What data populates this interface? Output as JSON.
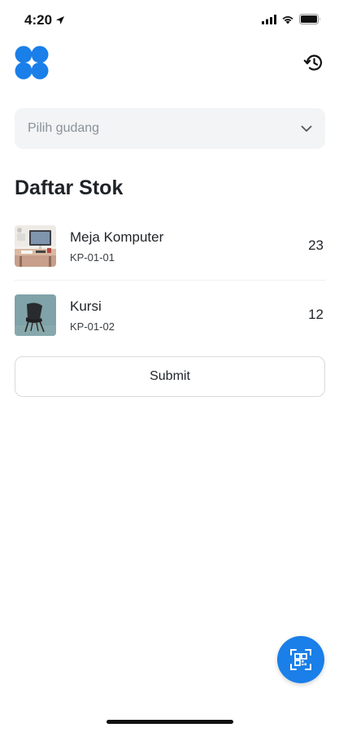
{
  "status_bar": {
    "time": "4:20"
  },
  "header": {
    "logo_icon": "app-logo-icon",
    "history_icon": "history-icon"
  },
  "warehouse_select": {
    "placeholder": "Pilih gudang",
    "icon": "chevron-down-icon"
  },
  "stock_section": {
    "title": "Daftar Stok",
    "items": [
      {
        "name": "Meja Komputer",
        "code": "KP-01-01",
        "qty": "23"
      },
      {
        "name": "Kursi",
        "code": "KP-01-02",
        "qty": "12"
      }
    ]
  },
  "submit": {
    "label": "Submit"
  },
  "fab": {
    "icon": "qr-scan-icon",
    "color": "#1a7fe8"
  },
  "colors": {
    "accent": "#1a7fe8",
    "select_bg": "#f2f4f5"
  }
}
